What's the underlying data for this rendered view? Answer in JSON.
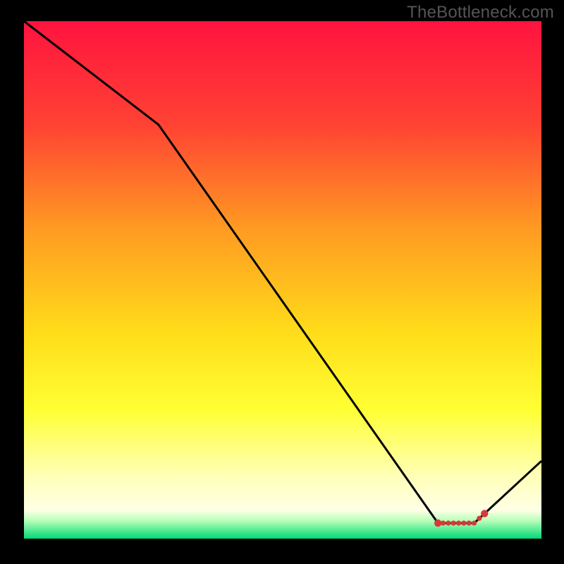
{
  "watermark": "TheBottleneck.com",
  "chart_data": {
    "type": "line",
    "title": "",
    "xlabel": "",
    "ylabel": "",
    "xlim": [
      0,
      100
    ],
    "ylim": [
      0,
      100
    ],
    "x": [
      0,
      26,
      80,
      87,
      100
    ],
    "values": [
      100,
      80,
      3,
      3,
      15
    ],
    "marker_region_x": [
      80,
      89
    ],
    "background": {
      "type": "vertical-gradient",
      "stops": [
        {
          "pos": 0.0,
          "color": "#ff133f"
        },
        {
          "pos": 0.2,
          "color": "#ff4233"
        },
        {
          "pos": 0.4,
          "color": "#ff9a22"
        },
        {
          "pos": 0.6,
          "color": "#ffdc1a"
        },
        {
          "pos": 0.75,
          "color": "#ffff33"
        },
        {
          "pos": 0.88,
          "color": "#ffffb8"
        },
        {
          "pos": 0.945,
          "color": "#ffffe6"
        },
        {
          "pos": 0.965,
          "color": "#b8ffb8"
        },
        {
          "pos": 1.0,
          "color": "#00d977"
        }
      ]
    },
    "line_color": "#000000",
    "marker_color": "#d43a3a"
  }
}
